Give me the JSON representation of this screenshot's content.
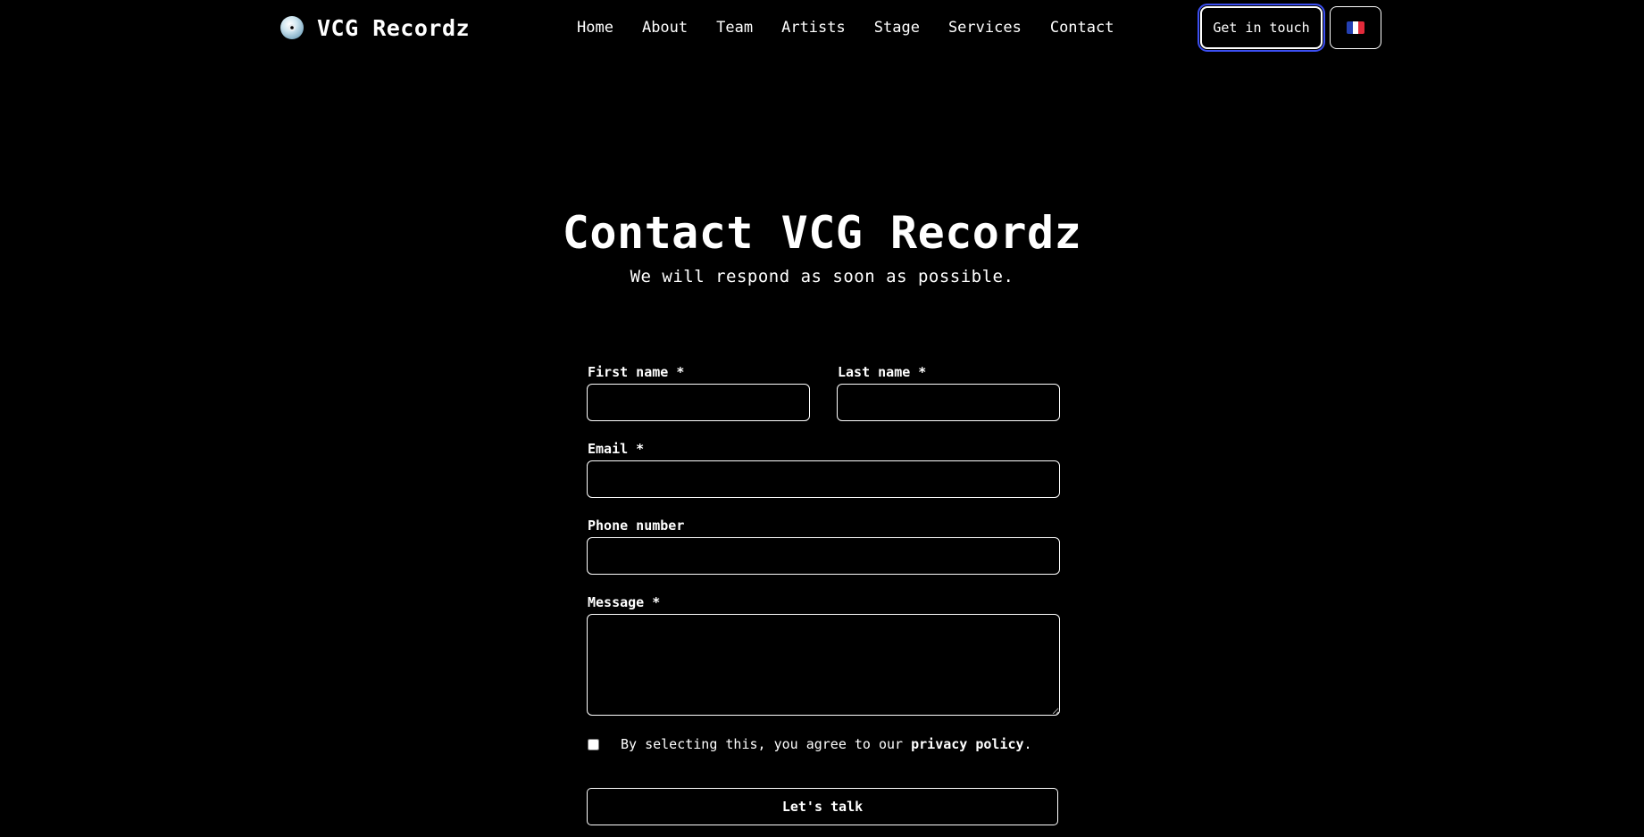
{
  "header": {
    "brand_name": "VCG Recordz",
    "brand_icon": "disc-icon",
    "nav": [
      {
        "label": "Home"
      },
      {
        "label": "About"
      },
      {
        "label": "Team"
      },
      {
        "label": "Artists"
      },
      {
        "label": "Stage"
      },
      {
        "label": "Services"
      },
      {
        "label": "Contact"
      }
    ],
    "cta_label": "Get in touch",
    "language_icon": "french-flag-icon"
  },
  "hero": {
    "title": "Contact VCG Recordz",
    "subtitle": "We will respond as soon as possible."
  },
  "form": {
    "first_name_label": "First name *",
    "first_name_value": "",
    "last_name_label": "Last name *",
    "last_name_value": "",
    "email_label": "Email *",
    "email_value": "",
    "phone_label": "Phone number",
    "phone_value": "",
    "message_label": "Message *",
    "message_value": "",
    "consent_prefix": "By selecting this, you agree to our ",
    "consent_link": "privacy policy",
    "consent_suffix": ".",
    "consent_checked": false,
    "submit_label": "Let's talk"
  },
  "colors": {
    "background": "#000000",
    "text": "#ffffff",
    "focus_ring": "#3b4ef0",
    "flag_blue": "#2440b3",
    "flag_white": "#ffffff",
    "flag_red": "#e22a3a"
  }
}
